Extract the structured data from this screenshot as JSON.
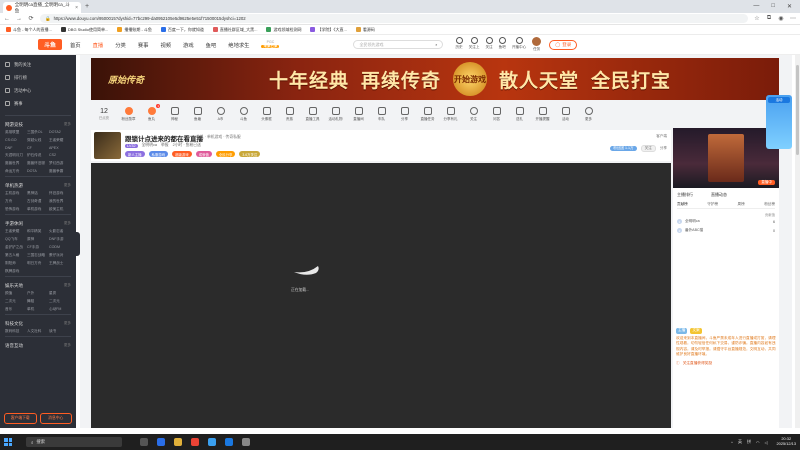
{
  "browser": {
    "tab_title": "全明明ca直播_全明明ca_斗鱼",
    "url": "https://www.douyu.com/9500015?dyshid=77bc299-da0952105e5d9625e5e51f71500015dyshci=1202",
    "bookmarks": [
      "斗鱼 - 每个人的直播...",
      "DBG Studio使用简单...",
      "播播账期 - 斗鱼",
      "百度一下，你就知道",
      "直播社群区域_大黑...",
      "游戏领域检测网",
      "【学院】《大直...",
      "看源码"
    ]
  },
  "header": {
    "logo": "斗鱼",
    "nav": [
      "首页",
      "直播",
      "分类",
      "赛事",
      "视频",
      "游戏",
      "鱼吧",
      "绝地求生"
    ],
    "pgc_top": "PGC",
    "pgc_bottom": "未来已来",
    "search_placeholder": "全民领先游戏",
    "icons": [
      "历史",
      "关注上",
      "关注",
      "鱼吧",
      "开播中心",
      "任务"
    ],
    "login": "登录"
  },
  "sidebar": {
    "top_items": [
      "我的关注",
      "排行榜",
      "活动中心",
      "赛事"
    ],
    "sections": [
      {
        "title": "网游竞技",
        "more": "更多",
        "items": [
          "英雄联盟",
          "三国杀OL",
          "DOTA2",
          "CS:GO",
          "穿越火线",
          "王者荣耀",
          "DNF",
          "CF",
          "APEX",
          "天涯明月刀",
          "炉石传说",
          "CS2",
          "魔兽世界",
          "魔兽怀旧服",
          "梦幻西游",
          "命运方舟",
          "DOTA",
          "魔兽争霸"
        ]
      },
      {
        "title": "单机热游",
        "more": "更多",
        "items": [
          "主机游戏",
          "黑神话",
          "怀旧游戏",
          "方舟",
          "古剑奇谭",
          "我的世界",
          "恐怖游戏",
          "单机游戏",
          "欧美主机"
        ]
      },
      {
        "title": "手游休闲",
        "more": "更多",
        "items": [
          "王者荣耀",
          "和平精英",
          "火影忍者",
          "QQ飞车",
          "原神",
          "DNF手游",
          "金铲铲之战",
          "CF手游",
          "CODM",
          "第五人格",
          "三国志战略",
          "蛋仔派对",
          "阴阳师",
          "明日方舟",
          "王牌战士",
          "棋牌游戏"
        ]
      },
      {
        "title": "娱乐天地",
        "more": "更多",
        "items": [
          "颜值",
          "户外",
          "星秀",
          "二次元",
          "舞蹈",
          "二次元",
          "音乐",
          "单机",
          "心动FM"
        ]
      },
      {
        "title": "科技文化",
        "more": "更多",
        "items": [
          "数码科技",
          "人文社科",
          "读书"
        ]
      },
      {
        "title": "语音互动",
        "more": "更多",
        "items": []
      }
    ],
    "bottom_buttons": [
      "客户端下载",
      "消息中心"
    ]
  },
  "banner": {
    "sub": "原始传奇",
    "left": "十年经典",
    "mid": "再续传奇",
    "btn": "开始游戏",
    "right": "散人天堂",
    "right2": "全民打宝"
  },
  "strip": {
    "count": "12",
    "count_label": "已点亮",
    "items": [
      "粉丝勋章",
      "鱼丸",
      "神秘",
      "鱼塘",
      "A币",
      "斗鱼",
      "头像框",
      "贵族",
      "直播工具",
      "活动礼物",
      "直播间",
      "车队",
      "分享",
      "直播任务",
      "分享有礼",
      "关注",
      "问答",
      "送礼",
      "开播提醒",
      "活动",
      "更多",
      "直播间",
      "关注",
      "主播",
      "宝箱"
    ],
    "badge": "1"
  },
  "room": {
    "title": "跟锁计点进来的都在看直播",
    "category": "单机 · 单机游戏 · 传奇私服",
    "level": "LV32",
    "name": "全明明ca",
    "report": "举报",
    "live_time": "2小时 · 鱼粉已送",
    "tags": [
      "新人主播",
      "私服游戏",
      "超级游戏",
      "成就值",
      "全民分享",
      "3.6万关注"
    ],
    "fans": "粉丝团",
    "fans_count": "1.1万",
    "follow": "关注",
    "share": "分享",
    "report2": "客户端"
  },
  "player": {
    "loading_text": "正在加载..."
  },
  "rightcol": {
    "live_tag": "直播中",
    "section_titles": [
      "主播排行",
      "直播动态"
    ],
    "tabs": [
      "贡献榜",
      "守护榜",
      "周榜",
      "粉丝榜"
    ],
    "rank_label": "贡献值",
    "ranks": [
      {
        "name": "全明明ca",
        "value": "6"
      },
      {
        "name": "番外ABC猫",
        "value": "0"
      }
    ],
    "chat_badges": [
      "主播",
      "文案"
    ],
    "chat": "欢迎来到本直播间，斗鱼严禁未成年人进行直播或打赏，请理性观看，切勿轻信任何私下交易，谨防诈骗。直播内容如有违规内容，请及时举报。请遵守平台直播规范，文明互动，共同维护良好直播环境。",
    "foot": "关注直播获得奖励"
  },
  "float_ad": {
    "tag": "活动"
  },
  "taskbar": {
    "search": "搜索",
    "time": "20:32",
    "date": "2025/12/13",
    "tray": [
      "英",
      "拼"
    ]
  }
}
